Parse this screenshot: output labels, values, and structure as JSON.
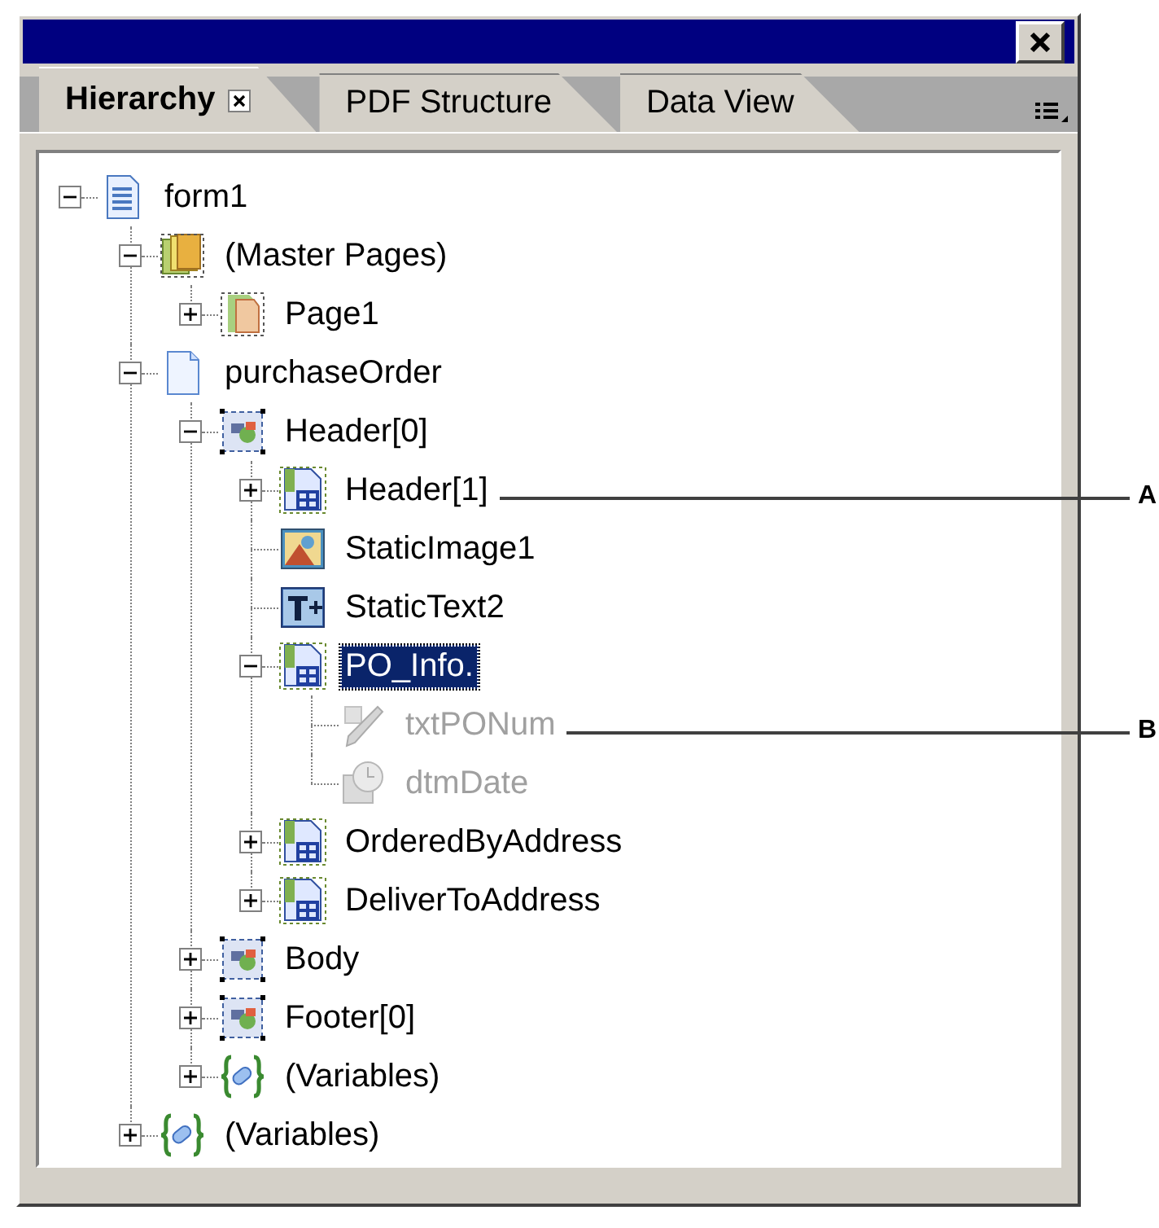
{
  "tabs": [
    {
      "label": "Hierarchy",
      "selected": true,
      "closable": true
    },
    {
      "label": "PDF Structure",
      "selected": false,
      "closable": false
    },
    {
      "label": "Data View",
      "selected": false,
      "closable": false
    }
  ],
  "tree": [
    {
      "label": "form1",
      "kind": "document",
      "expanded": true,
      "selected": false,
      "disabled": false,
      "children": [
        {
          "label": "(Master Pages)",
          "kind": "master-pages",
          "expanded": true,
          "selected": false,
          "disabled": false,
          "children": [
            {
              "label": "Page1",
              "kind": "page",
              "expanded": false,
              "selected": false,
              "disabled": false
            }
          ]
        },
        {
          "label": "purchaseOrder",
          "kind": "document-blank",
          "expanded": true,
          "selected": false,
          "disabled": false,
          "children": [
            {
              "label": "Header[0]",
              "kind": "subform",
              "expanded": true,
              "selected": false,
              "disabled": false,
              "children": [
                {
                  "label": "Header[1]",
                  "kind": "subform-group",
                  "expanded": false,
                  "selected": false,
                  "disabled": false,
                  "callout": "A"
                },
                {
                  "label": "StaticImage1",
                  "kind": "image",
                  "selected": false,
                  "disabled": false
                },
                {
                  "label": "StaticText2",
                  "kind": "text",
                  "selected": false,
                  "disabled": false
                },
                {
                  "label": "PO_Info.",
                  "kind": "subform-group",
                  "expanded": true,
                  "selected": true,
                  "disabled": false,
                  "children": [
                    {
                      "label": "txtPONum",
                      "kind": "field",
                      "selected": false,
                      "disabled": true,
                      "callout": "B"
                    },
                    {
                      "label": "dtmDate",
                      "kind": "date",
                      "selected": false,
                      "disabled": true
                    }
                  ]
                },
                {
                  "label": "OrderedByAddress",
                  "kind": "subform-group",
                  "expanded": false,
                  "selected": false,
                  "disabled": false
                },
                {
                  "label": "DeliverToAddress",
                  "kind": "subform-group",
                  "expanded": false,
                  "selected": false,
                  "disabled": false
                }
              ]
            },
            {
              "label": "Body",
              "kind": "subform",
              "expanded": false,
              "selected": false,
              "disabled": false
            },
            {
              "label": "Footer[0]",
              "kind": "subform",
              "expanded": false,
              "selected": false,
              "disabled": false
            },
            {
              "label": "(Variables)",
              "kind": "variables",
              "expanded": false,
              "selected": false,
              "disabled": false
            }
          ]
        },
        {
          "label": "(Variables)",
          "kind": "variables",
          "expanded": false,
          "selected": false,
          "disabled": false
        }
      ]
    }
  ]
}
